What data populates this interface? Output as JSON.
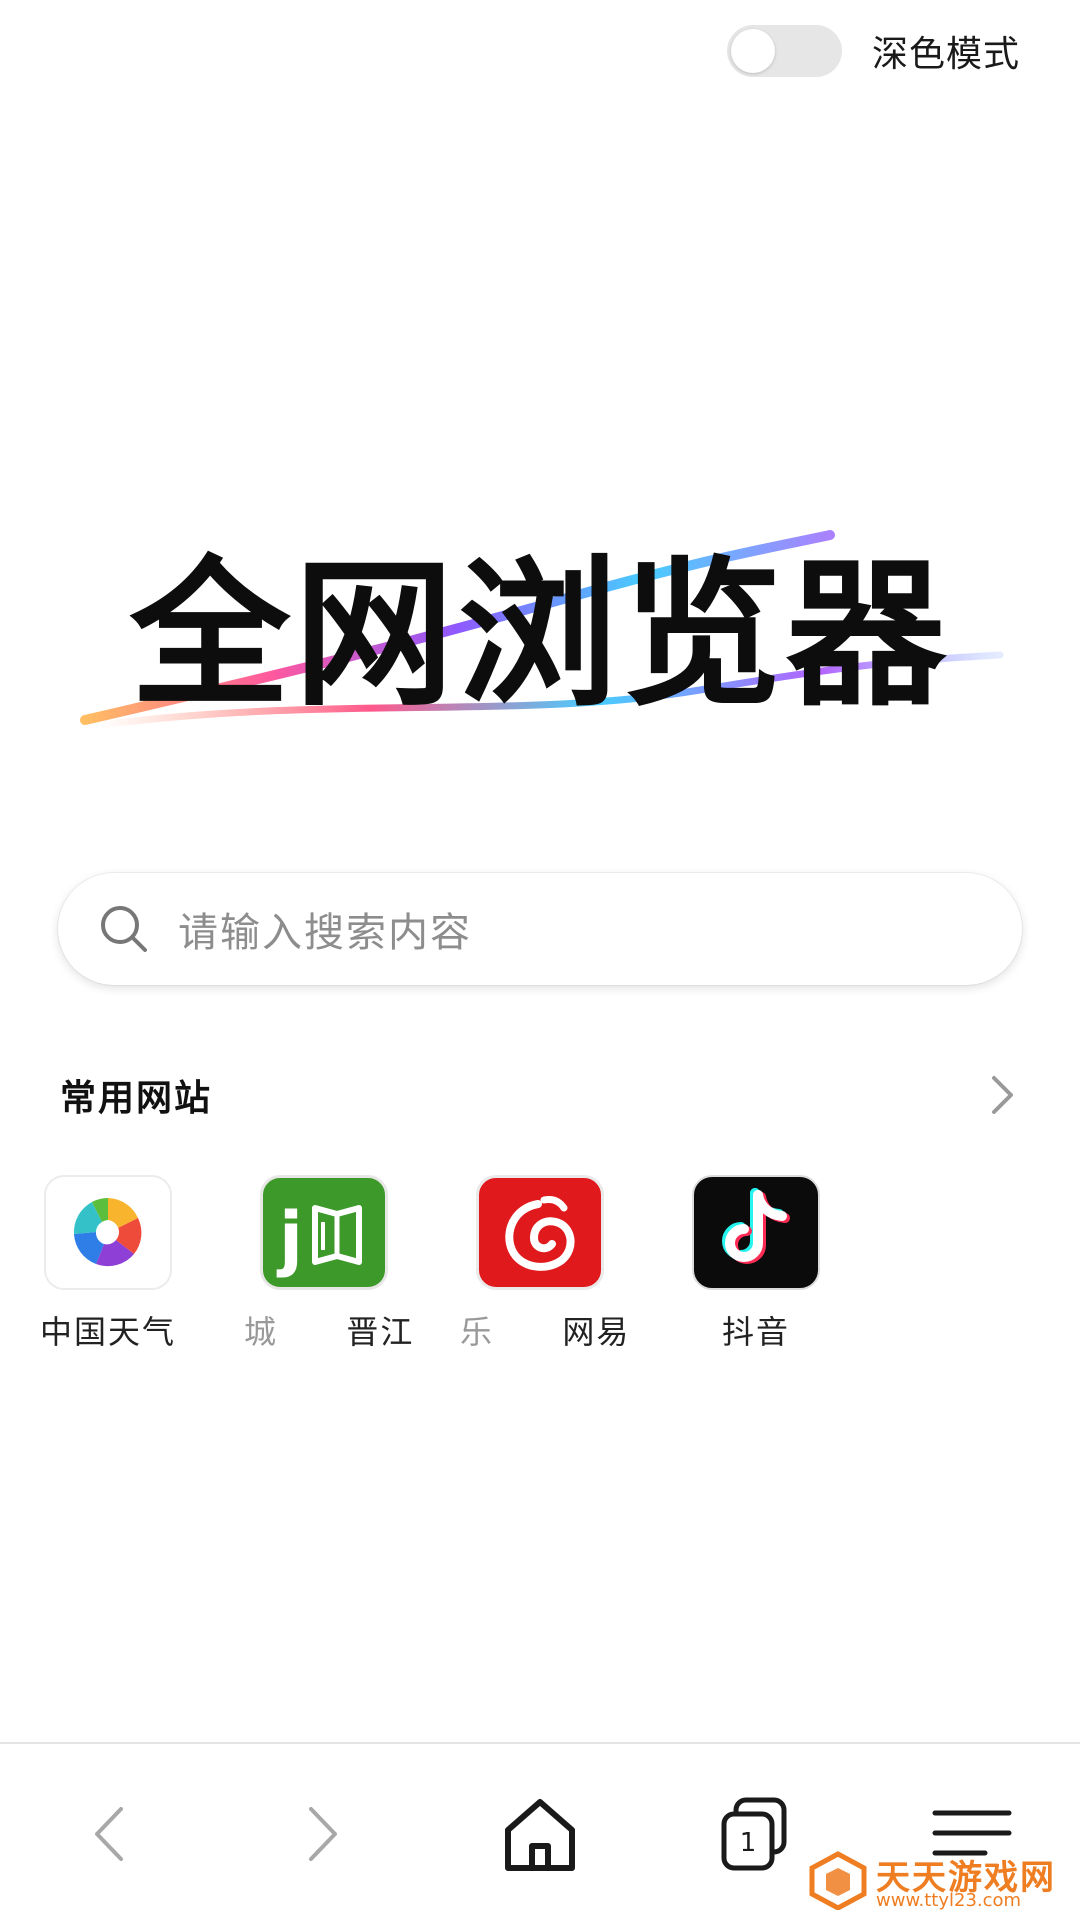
{
  "top_bar": {
    "dark_mode_label": "深色模式",
    "dark_mode_on": false
  },
  "logo": {
    "text": "全网浏览器"
  },
  "search": {
    "placeholder": "请输入搜索内容"
  },
  "sites": {
    "title": "常用网站",
    "items": [
      {
        "label": "中国天气",
        "icon": "china-weather-icon"
      },
      {
        "label": "晋江",
        "prefix_fragment": "城",
        "icon": "jinjiang-icon",
        "color": "#3d9a2a"
      },
      {
        "label": "网易",
        "prefix_fragment": "乐",
        "icon": "netease-music-icon",
        "color": "#e0191c"
      },
      {
        "label": "抖音",
        "icon": "douyin-icon",
        "color": "#000000"
      }
    ]
  },
  "bottom_nav": {
    "tab_count": "1"
  },
  "watermark": {
    "title": "天天游戏网",
    "url": "www.ttyl23.com"
  },
  "colors": {
    "accent_watermark": "#ef7d22",
    "toggle_off": "#e6e6e6"
  }
}
